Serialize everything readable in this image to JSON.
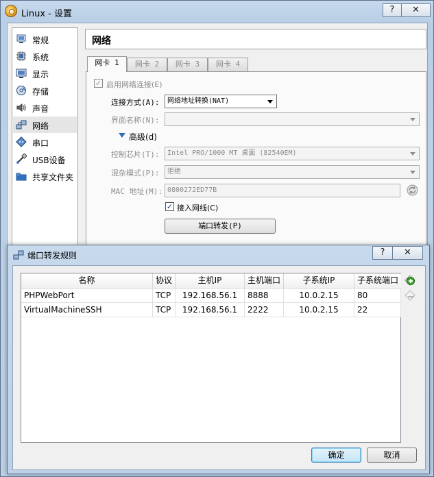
{
  "main_window": {
    "title": "Linux - 设置",
    "help_btn": "?",
    "close_btn": "✕"
  },
  "sidebar": {
    "items": [
      {
        "label": "常规",
        "icon": "general-icon"
      },
      {
        "label": "系统",
        "icon": "system-icon"
      },
      {
        "label": "显示",
        "icon": "display-icon"
      },
      {
        "label": "存储",
        "icon": "storage-icon"
      },
      {
        "label": "声音",
        "icon": "audio-icon"
      },
      {
        "label": "网络",
        "icon": "network-icon",
        "selected": true
      },
      {
        "label": "串口",
        "icon": "serial-port-icon"
      },
      {
        "label": "USB设备",
        "icon": "usb-icon"
      },
      {
        "label": "共享文件夹",
        "icon": "shared-folder-icon"
      }
    ]
  },
  "section": {
    "title": "网络"
  },
  "tabs": [
    "网卡 1",
    "网卡 2",
    "网卡 3",
    "网卡 4"
  ],
  "adapter": {
    "enable_label": "启用网络连接(E)",
    "attach_label": "连接方式(A):",
    "attach_value": "网络地址转换(NAT)",
    "name_label": "界面名称(N):",
    "name_value": "",
    "advanced_label": "高级(d)",
    "chip_label": "控制芯片(T):",
    "chip_value": "Intel PRO/1000 MT 桌面 (82540EM)",
    "promisc_label": "混杂模式(P):",
    "promisc_value": "拒绝",
    "mac_label": "MAC 地址(M):",
    "mac_value": "0800272ED77B",
    "cable_label": "接入网线(C)",
    "port_forward_button": "端口转发(P)"
  },
  "dialog": {
    "title": "端口转发规则",
    "help_btn": "?",
    "close_btn": "✕",
    "columns": [
      "名称",
      "协议",
      "主机IP",
      "主机端口",
      "子系统IP",
      "子系统端口"
    ],
    "rows": [
      [
        "PHPWebPort",
        "TCP",
        "192.168.56.1",
        "8888",
        "10.0.2.15",
        "80"
      ],
      [
        "VirtualMachineSSH",
        "TCP",
        "192.168.56.1",
        "2222",
        "10.0.2.15",
        "22"
      ]
    ],
    "ok_button": "确定",
    "cancel_button": "取消"
  },
  "colors": {
    "titlebar": "#bdd1e7",
    "window_bg": "#f0f0f0",
    "accent": "#3c7fb1",
    "add_icon": "#3aa52a"
  }
}
